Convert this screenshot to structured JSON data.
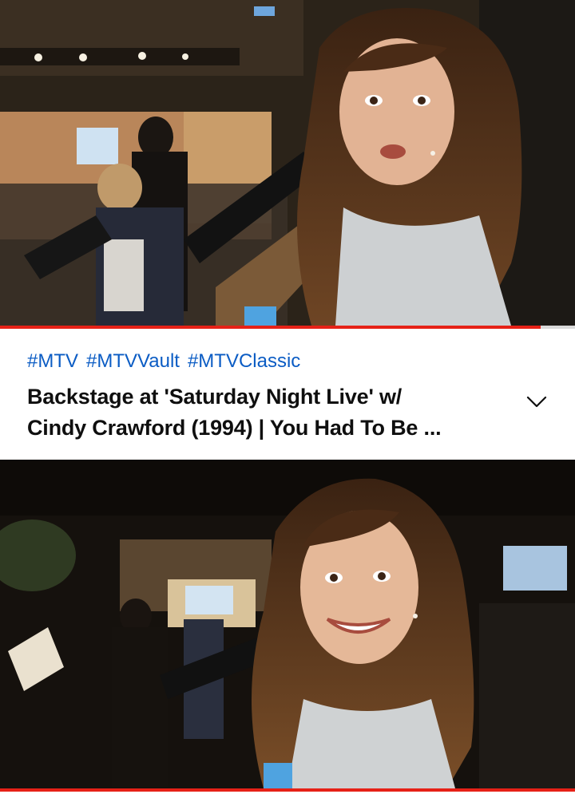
{
  "video_top": {
    "scene_icon": "video-still-backstage",
    "progress_percent": 94
  },
  "info_panel": {
    "hashtags": [
      "#MTV",
      "#MTVVault",
      "#MTVClassic"
    ],
    "title_line_1": "Backstage at 'Saturday Night Live' w/",
    "title_line_2": "Cindy Crawford (1994) | You Had To Be ...",
    "expand_icon": "chevron-down-icon"
  },
  "video_bottom": {
    "scene_icon": "video-still-backstage-closeup",
    "progress_percent": 100
  },
  "colors": {
    "hashtag": "#0b5cc4",
    "title": "#0f0f0f",
    "progress": "#e62117",
    "progress_track": "#d9d9d9"
  }
}
